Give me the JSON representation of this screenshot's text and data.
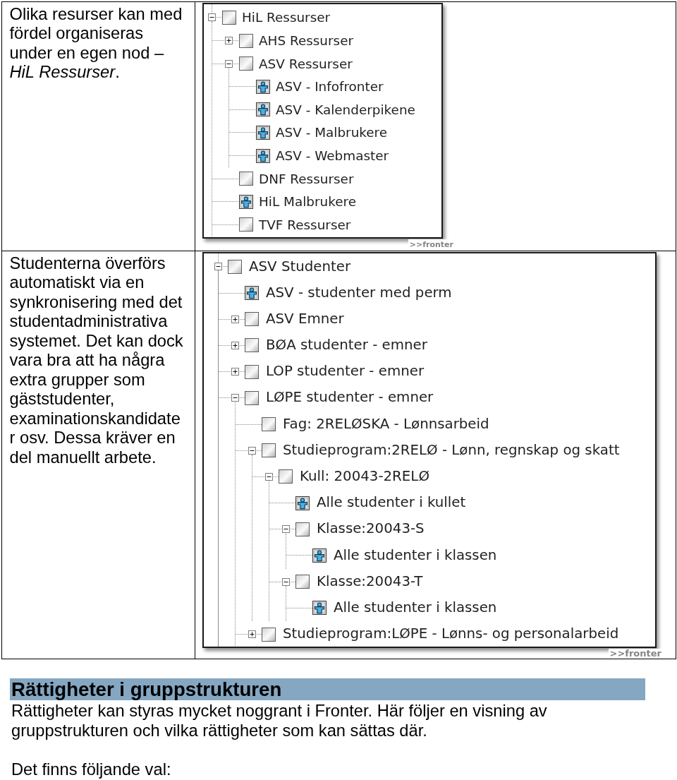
{
  "rows": [
    {
      "text": "Olika resurser kan med fördel organiseras under en egen nod – *HiL Ressurser*.",
      "screenshot": {
        "tree": [
          {
            "label": "HiL Ressurser",
            "kind": "folder",
            "expanded": true,
            "children": [
              {
                "label": "AHS Ressurser",
                "kind": "folder",
                "expanded": false
              },
              {
                "label": "ASV Ressurser",
                "kind": "folder",
                "expanded": true,
                "children": [
                  {
                    "label": "ASV - Infofronter",
                    "kind": "group"
                  },
                  {
                    "label": "ASV - Kalenderpikene",
                    "kind": "group"
                  },
                  {
                    "label": "ASV - Malbrukere",
                    "kind": "group"
                  },
                  {
                    "label": "ASV - Webmaster",
                    "kind": "group"
                  }
                ]
              },
              {
                "label": "DNF Ressurser",
                "kind": "folder"
              },
              {
                "label": "HiL Malbrukere",
                "kind": "group"
              },
              {
                "label": "TVF Ressurser",
                "kind": "folder"
              }
            ]
          }
        ],
        "logo": ">>fronter"
      }
    },
    {
      "text": "Studenterna överförs automatiskt via en synkronisering med det studentadministrativa systemet. Det kan dock vara bra att ha några extra grupper som gäststudenter, examinationskandidater osv. Dessa kräver en del manuellt arbete.",
      "screenshot": {
        "tree": [
          {
            "label": "ASV Studenter",
            "kind": "folder",
            "expanded": true,
            "children": [
              {
                "label": "ASV - studenter med perm",
                "kind": "group"
              },
              {
                "label": "ASV Emner",
                "kind": "folder",
                "expanded": false
              },
              {
                "label": "BØA studenter - emner",
                "kind": "folder",
                "expanded": false
              },
              {
                "label": "LOP studenter - emner",
                "kind": "folder",
                "expanded": false
              },
              {
                "label": "LØPE studenter - emner",
                "kind": "folder",
                "expanded": true,
                "children": [
                  {
                    "label": "Fag: 2RELØSKA - Lønnsarbeid",
                    "kind": "folder"
                  },
                  {
                    "label": "Studieprogram:2RELØ - Lønn, regnskap og skatt",
                    "kind": "folder",
                    "expanded": true,
                    "children": [
                      {
                        "label": "Kull: 20043-2RELØ",
                        "kind": "folder",
                        "expanded": true,
                        "children": [
                          {
                            "label": "Alle studenter i kullet",
                            "kind": "group"
                          },
                          {
                            "label": "Klasse:20043-S",
                            "kind": "folder",
                            "expanded": true,
                            "children": [
                              {
                                "label": "Alle studenter i klassen",
                                "kind": "group"
                              }
                            ]
                          },
                          {
                            "label": "Klasse:20043-T",
                            "kind": "folder",
                            "expanded": true,
                            "children": [
                              {
                                "label": "Alle studenter i klassen",
                                "kind": "group"
                              }
                            ]
                          }
                        ]
                      }
                    ]
                  },
                  {
                    "label": "Studieprogram:LØPE - Lønns- og personalarbeid",
                    "kind": "folder",
                    "expanded": false
                  }
                ]
              }
            ]
          }
        ],
        "logo": ">>fronter"
      }
    }
  ],
  "section": {
    "heading": "Rättigheter i gruppstrukturen",
    "paragraphs": [
      "Rättigheter kan styras mycket noggrant i Fronter. Här följer en visning av gruppstrukturen och vilka rättigheter som kan sättas där.",
      "Det finns följande val:"
    ]
  }
}
